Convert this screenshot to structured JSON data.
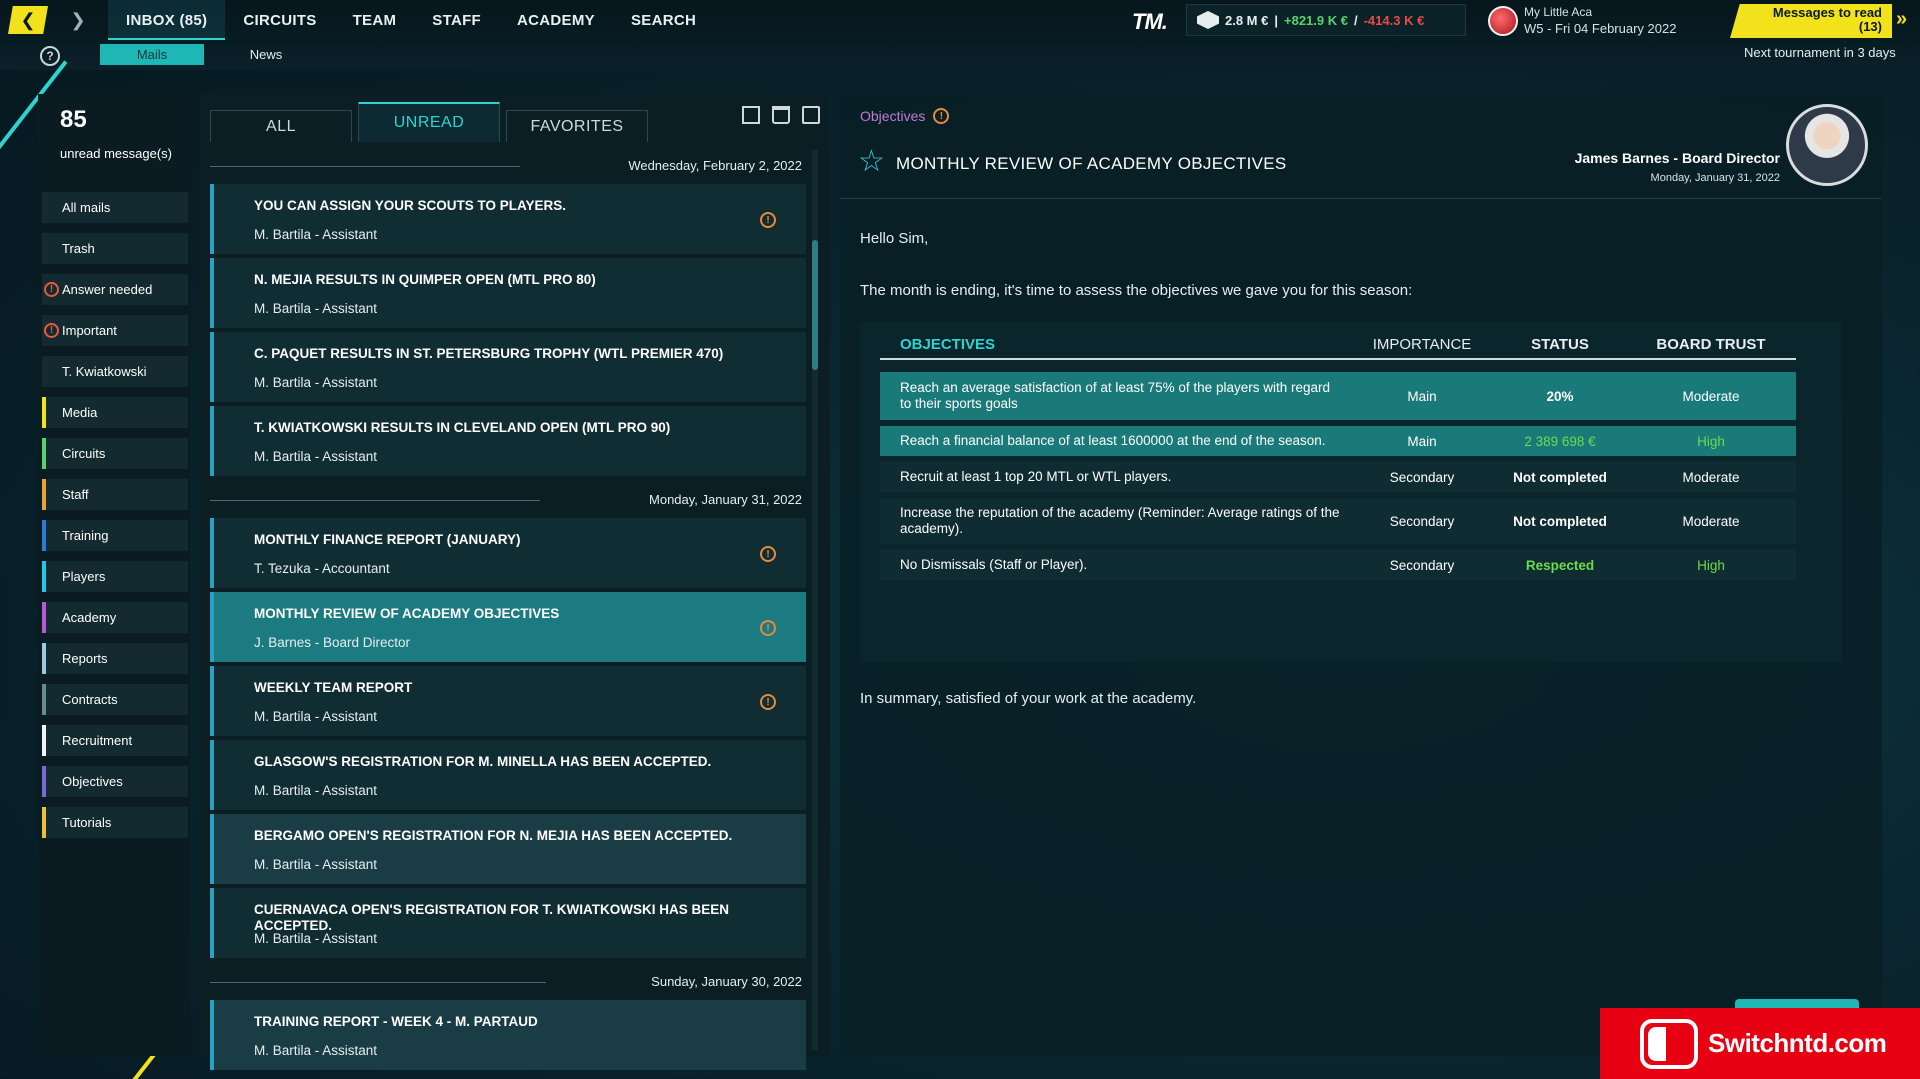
{
  "topbar": {
    "main_tabs": [
      "INBOX (85)",
      "CIRCUITS",
      "TEAM",
      "STAFF",
      "ACADEMY",
      "SEARCH"
    ],
    "sub_tabs": [
      "Mails",
      "News"
    ],
    "brand": "TM.",
    "money": {
      "balance": "2.8 M €",
      "sep": "|",
      "income": "+821.9 K €",
      "slash": "/",
      "expense": "-414.3 K €"
    },
    "club_name": "My Little Aca",
    "club_date": "W5 - Fri 04 February 2022",
    "messages_to_read": "Messages to read",
    "messages_count": "(13)",
    "next_tournament": "Next tournament in 3 days"
  },
  "sidebar": {
    "unread_count": "85",
    "unread_label": "unread message(s)",
    "items": [
      {
        "label": "All mails",
        "color": "",
        "warn": false
      },
      {
        "label": "Trash",
        "color": "",
        "warn": false
      },
      {
        "label": "Answer needed",
        "color": "",
        "warn": true
      },
      {
        "label": "Important",
        "color": "",
        "warn": true
      },
      {
        "label": "T. Kwiatkowski",
        "color": "",
        "warn": false
      },
      {
        "label": "Media",
        "color": "#f2e21b",
        "warn": false
      },
      {
        "label": "Circuits",
        "color": "#58d26c",
        "warn": false
      },
      {
        "label": "Staff",
        "color": "#e8a23a",
        "warn": false
      },
      {
        "label": "Training",
        "color": "#2a7ad6",
        "warn": false
      },
      {
        "label": "Players",
        "color": "#2ac4e8",
        "warn": false
      },
      {
        "label": "Academy",
        "color": "#b45ad6",
        "warn": false
      },
      {
        "label": "Reports",
        "color": "#9fc8e0",
        "warn": false
      },
      {
        "label": "Contracts",
        "color": "#6a8a92",
        "warn": false
      },
      {
        "label": "Recruitment",
        "color": "#f2f2f2",
        "warn": false
      },
      {
        "label": "Objectives",
        "color": "#7a6ad6",
        "warn": false
      },
      {
        "label": "Tutorials",
        "color": "#e8c23a",
        "warn": false
      }
    ]
  },
  "mail_tabs": [
    "ALL",
    "UNREAD",
    "FAVORITES"
  ],
  "mail_groups": [
    {
      "date": "Wednesday, February 2, 2022",
      "mails": [
        {
          "subject": "YOU CAN ASSIGN YOUR SCOUTS TO PLAYERS.",
          "from": "M. Bartila - Assistant",
          "warn": true,
          "state": ""
        },
        {
          "subject": "N. MEJIA RESULTS IN QUIMPER OPEN (MTL PRO 80)",
          "from": "M. Bartila - Assistant",
          "warn": false,
          "state": ""
        },
        {
          "subject": "C. PAQUET RESULTS IN ST. PETERSBURG TROPHY (WTL PREMIER 470)",
          "from": "M. Bartila - Assistant",
          "warn": false,
          "state": ""
        },
        {
          "subject": "T. KWIATKOWSKI RESULTS IN CLEVELAND OPEN (MTL PRO 90)",
          "from": "M. Bartila - Assistant",
          "warn": false,
          "state": ""
        }
      ]
    },
    {
      "date": "Monday, January 31, 2022",
      "mails": [
        {
          "subject": "MONTHLY FINANCE REPORT (JANUARY)",
          "from": "T. Tezuka - Accountant",
          "warn": true,
          "state": ""
        },
        {
          "subject": "MONTHLY REVIEW OF ACADEMY OBJECTIVES",
          "from": "J. Barnes - Board Director",
          "warn": true,
          "state": "selected"
        },
        {
          "subject": "WEEKLY TEAM REPORT",
          "from": "M. Bartila - Assistant",
          "warn": true,
          "state": ""
        },
        {
          "subject": "GLASGOW'S REGISTRATION FOR M. MINELLA HAS BEEN ACCEPTED.",
          "from": "M. Bartila - Assistant",
          "warn": false,
          "state": ""
        },
        {
          "subject": "BERGAMO OPEN'S REGISTRATION FOR N. MEJIA HAS BEEN ACCEPTED.",
          "from": "M. Bartila - Assistant",
          "warn": false,
          "state": "read"
        },
        {
          "subject": "CUERNAVACA OPEN'S REGISTRATION FOR T. KWIATKOWSKI HAS BEEN ACCEPTED.",
          "from": "M. Bartila - Assistant",
          "warn": false,
          "state": ""
        }
      ]
    },
    {
      "date": "Sunday, January 30, 2022",
      "mails": [
        {
          "subject": "TRAINING REPORT - WEEK 4 - M. PARTAUD",
          "from": "M. Bartila - Assistant",
          "warn": false,
          "state": "read"
        }
      ]
    }
  ],
  "message": {
    "breadcrumb": "Objectives",
    "title": "MONTHLY REVIEW OF ACADEMY OBJECTIVES",
    "sender": "James Barnes - Board Director",
    "sender_date": "Monday, January 31, 2022",
    "greeting": "Hello Sim,",
    "intro": "The month is ending, it's time to assess the objectives we gave you for this season:",
    "table_headers": [
      "OBJECTIVES",
      "IMPORTANCE",
      "STATUS",
      "BOARD TRUST"
    ],
    "objectives": [
      {
        "text": "Reach an average satisfaction of at least 75% of the players with regard to their sports goals",
        "importance": "Main",
        "status": "20%",
        "trust": "Moderate",
        "highlight": true,
        "status_green": false,
        "trust_green": false
      },
      {
        "text": "Reach a financial balance of at least 1600000 at the end of the season.",
        "importance": "Main",
        "status": "2 389 698 €",
        "trust": "High",
        "highlight": true,
        "status_green": true,
        "trust_green": true
      },
      {
        "text": "Recruit at least 1 top 20 MTL or WTL players.",
        "importance": "Secondary",
        "status": "Not completed",
        "trust": "Moderate",
        "highlight": false,
        "status_green": false,
        "trust_green": false
      },
      {
        "text": "Increase the reputation of the academy (Reminder: Average ratings of the academy).",
        "importance": "Secondary",
        "status": "Not completed",
        "trust": "Moderate",
        "highlight": false,
        "status_green": false,
        "trust_green": false
      },
      {
        "text": "No Dismissals (Staff or Player).",
        "importance": "Secondary",
        "status": "Respected",
        "trust": "High",
        "highlight": false,
        "status_green": true,
        "trust_green": true
      }
    ],
    "summary": "In summary, satisfied of your work at the academy."
  },
  "watermark": "Switchntd.com",
  "colors": {
    "accent": "#2ed3d0",
    "yellow": "#f2e21b",
    "selected": "#1b7b80"
  }
}
